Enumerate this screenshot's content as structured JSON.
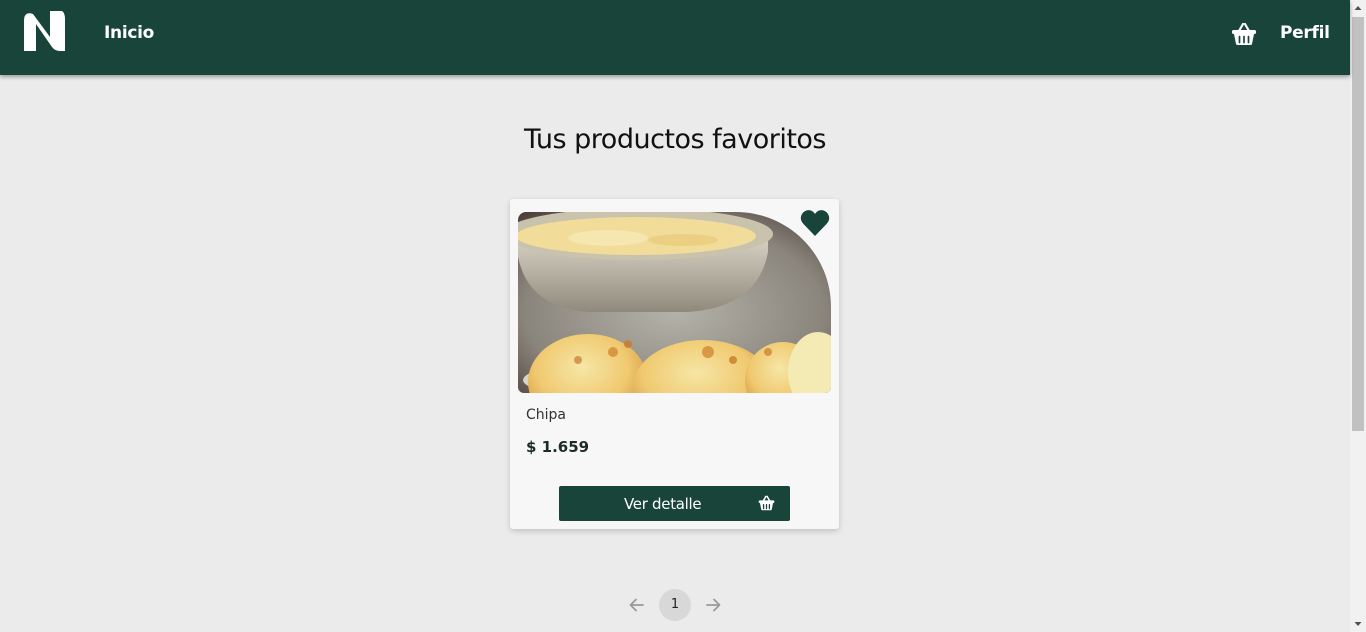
{
  "header": {
    "nav_home": "Inicio",
    "nav_profile": "Perfil",
    "logo_icon": "brand-n-logo",
    "cart_icon": "shopping-basket-icon",
    "bg_color": "#18443a"
  },
  "main": {
    "title": "Tus productos favoritos"
  },
  "products": [
    {
      "name": "Chipa",
      "price": "$ 1.659",
      "favorite": true,
      "favorite_icon": "heart-icon",
      "detail_button": "Ver detalle",
      "detail_button_icon": "shopping-basket-icon"
    }
  ],
  "pagination": {
    "current_page": "1",
    "prev_icon": "arrow-left-icon",
    "next_icon": "arrow-right-icon"
  },
  "colors": {
    "brand": "#18443a",
    "background": "#ebebeb",
    "card": "#f7f7f7"
  }
}
